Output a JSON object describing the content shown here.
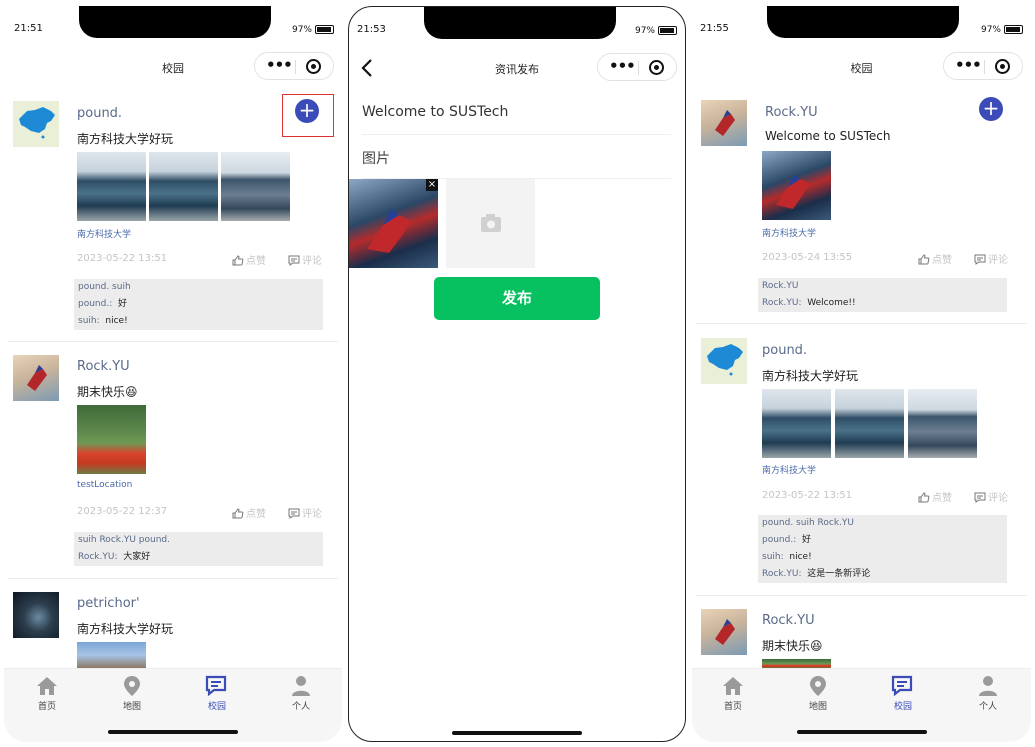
{
  "tabs": [
    {
      "key": "home",
      "label": "首页",
      "icon": "home-icon"
    },
    {
      "key": "map",
      "label": "地图",
      "icon": "map-pin-icon"
    },
    {
      "key": "campus",
      "label": "校园",
      "icon": "chat-icon"
    },
    {
      "key": "profile",
      "label": "个人",
      "icon": "user-icon"
    }
  ],
  "colors": {
    "accent": "#3b4bb8",
    "publish_green": "#07c160",
    "highlight_red": "#e0302f"
  },
  "screen1": {
    "status": {
      "time": "21:51",
      "battery": "97%"
    },
    "title": "校园",
    "posts": [
      {
        "user": "pound.",
        "text": "南方科技大学好玩",
        "location": "南方科技大学",
        "date": "2023-05-22 13:51",
        "like_label": "点赞",
        "comment_label": "评论",
        "likers": "pound. suih",
        "comments": [
          {
            "name": "pound.:",
            "text": "好"
          },
          {
            "name": "suih:",
            "text": "nice!"
          }
        ]
      },
      {
        "user": "Rock.YU",
        "text": "期末快乐😆",
        "location": "testLocation",
        "date": "2023-05-22 12:37",
        "like_label": "点赞",
        "comment_label": "评论",
        "likers": "suih Rock.YU pound.",
        "comments": [
          {
            "name": "Rock.YU:",
            "text": "大家好"
          }
        ]
      },
      {
        "user": "petrichor'",
        "text": "南方科技大学好玩"
      }
    ]
  },
  "screen2": {
    "status": {
      "time": "21:53",
      "battery": "97%"
    },
    "title": "资讯发布",
    "post_title": "Welcome to SUSTech",
    "image_label": "图片",
    "close_glyph": "×",
    "publish_label": "发布"
  },
  "screen3": {
    "status": {
      "time": "21:55",
      "battery": "97%"
    },
    "title": "校园",
    "posts": [
      {
        "user": "Rock.YU",
        "text": "Welcome to SUSTech",
        "location": "南方科技大学",
        "date": "2023-05-24 13:55",
        "like_label": "点赞",
        "comment_label": "评论",
        "likers": "Rock.YU",
        "comments": [
          {
            "name": "Rock.YU:",
            "text": "Welcome!!"
          }
        ]
      },
      {
        "user": "pound.",
        "text": "南方科技大学好玩",
        "location": "南方科技大学",
        "date": "2023-05-22 13:51",
        "like_label": "点赞",
        "comment_label": "评论",
        "likers": "pound. suih Rock.YU",
        "comments": [
          {
            "name": "pound.:",
            "text": "好"
          },
          {
            "name": "suih:",
            "text": "nice!"
          },
          {
            "name": "Rock.YU:",
            "text": "这是一条新评论"
          }
        ]
      },
      {
        "user": "Rock.YU",
        "text": "期末快乐😆"
      }
    ]
  }
}
